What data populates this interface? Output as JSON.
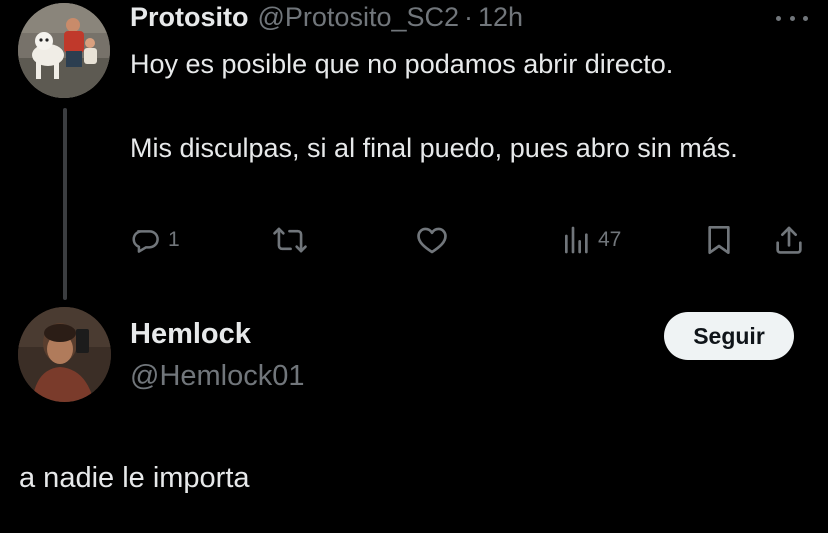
{
  "tweet": {
    "author_name": "Protosito",
    "author_handle": "@Protosito_SC2",
    "separator": "·",
    "time": "12h",
    "body_line1": "Hoy es posible que no podamos abrir directo.",
    "body_line2": "Mis disculpas, si al final puedo, pues abro sin más.",
    "actions": {
      "reply_count": "1",
      "views_count": "47",
      "reply_icon": "reply-icon",
      "retweet_icon": "retweet-icon",
      "like_icon": "heart-icon",
      "views_icon": "views-icon",
      "bookmark_icon": "bookmark-icon",
      "share_icon": "share-icon"
    }
  },
  "reply": {
    "author_name": "Hemlock",
    "author_handle": "@Hemlock01",
    "follow_label": "Seguir",
    "body": "a nadie le importa"
  },
  "colors": {
    "background": "#000000",
    "text_primary": "#e7e9ea",
    "text_secondary": "#71767b",
    "button_bg": "#eff3f4",
    "button_text": "#0f1419"
  }
}
